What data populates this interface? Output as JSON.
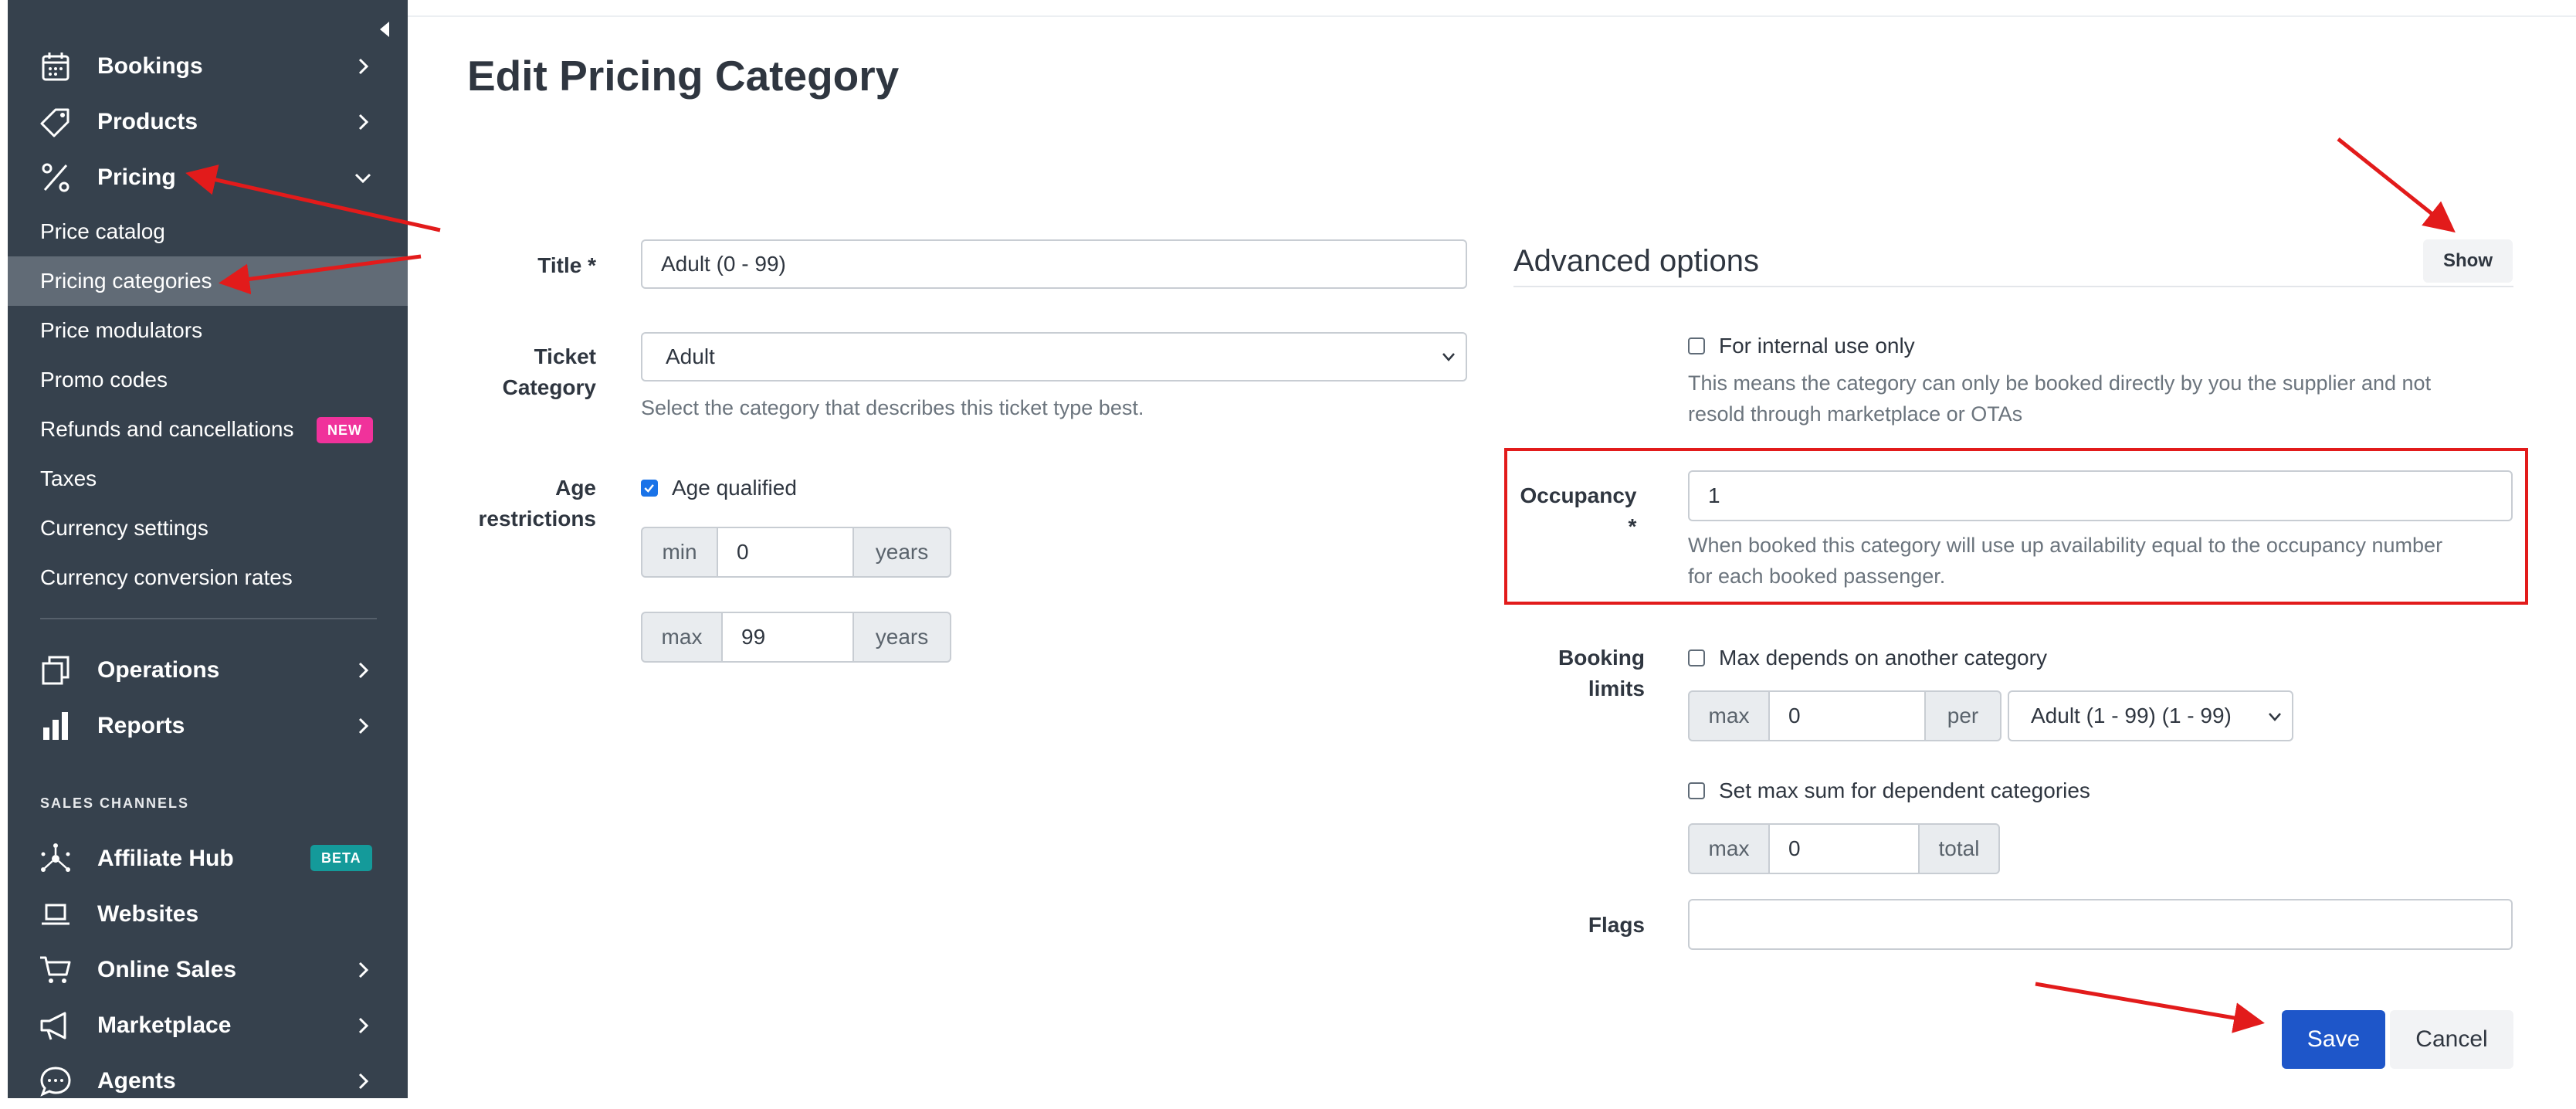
{
  "sidebar": {
    "nav": [
      {
        "label": "Bookings",
        "icon": "calendar-icon"
      },
      {
        "label": "Products",
        "icon": "tag-icon"
      },
      {
        "label": "Pricing",
        "icon": "percent-icon"
      }
    ],
    "pricing_sub": [
      {
        "label": "Price catalog"
      },
      {
        "label": "Pricing categories"
      },
      {
        "label": "Price modulators"
      },
      {
        "label": "Promo codes"
      },
      {
        "label": "Refunds and cancellations",
        "badge": "NEW"
      },
      {
        "label": "Taxes"
      },
      {
        "label": "Currency settings"
      },
      {
        "label": "Currency conversion rates"
      }
    ],
    "nav2": [
      {
        "label": "Operations",
        "icon": "copy-icon"
      },
      {
        "label": "Reports",
        "icon": "bar-chart-icon"
      }
    ],
    "sales_heading": "SALES CHANNELS",
    "sales": [
      {
        "label": "Affiliate Hub",
        "icon": "network-icon",
        "badge": "BETA"
      },
      {
        "label": "Websites",
        "icon": "laptop-icon"
      },
      {
        "label": "Online Sales",
        "icon": "cart-icon"
      },
      {
        "label": "Marketplace",
        "icon": "megaphone-icon"
      },
      {
        "label": "Agents",
        "icon": "chat-icon"
      }
    ],
    "badge_colors": {
      "new": "#f0329b",
      "beta": "#149a9a"
    }
  },
  "page": {
    "title": "Edit Pricing Category"
  },
  "form": {
    "title_label": "Title *",
    "title_value": "Adult (0 - 99)",
    "ticket_label_1": "Ticket",
    "ticket_label_2": "Category",
    "ticket_value": "Adult",
    "ticket_help": "Select the category that describes this ticket type best.",
    "age_label_1": "Age",
    "age_label_2": "restrictions",
    "age_qualified": "Age qualified",
    "min_label": "min",
    "min_value": "0",
    "max_label": "max",
    "max_value": "99",
    "years": "years"
  },
  "advanced": {
    "title": "Advanced options",
    "show": "Show",
    "internal": "For internal use only",
    "internal_help_1": "This means the category can only be booked directly by you the supplier and not",
    "internal_help_2": "resold through marketplace or OTAs",
    "occupancy_label_1": "Occupancy",
    "occupancy_label_2": "*",
    "occupancy_value": "1",
    "occupancy_help_1": "When booked this category will use up availability equal to the occupancy number",
    "occupancy_help_2": "for each booked passenger.",
    "booking_label_1": "Booking",
    "booking_label_2": "limits",
    "max_depends": "Max depends on another category",
    "max_label": "max",
    "max_value": "0",
    "per_label": "per",
    "per_select": "Adult (1 - 99) (1 - 99)",
    "set_max_sum": "Set max sum for dependent categories",
    "sum_max_label": "max",
    "sum_value": "0",
    "total_label": "total",
    "flags_label": "Flags",
    "flags_value": ""
  },
  "actions": {
    "save": "Save",
    "cancel": "Cancel"
  },
  "colors": {
    "sidebar": "#36414d",
    "active": "#616b76",
    "primary": "#1e56c9",
    "annotation": "#e21b1b"
  }
}
